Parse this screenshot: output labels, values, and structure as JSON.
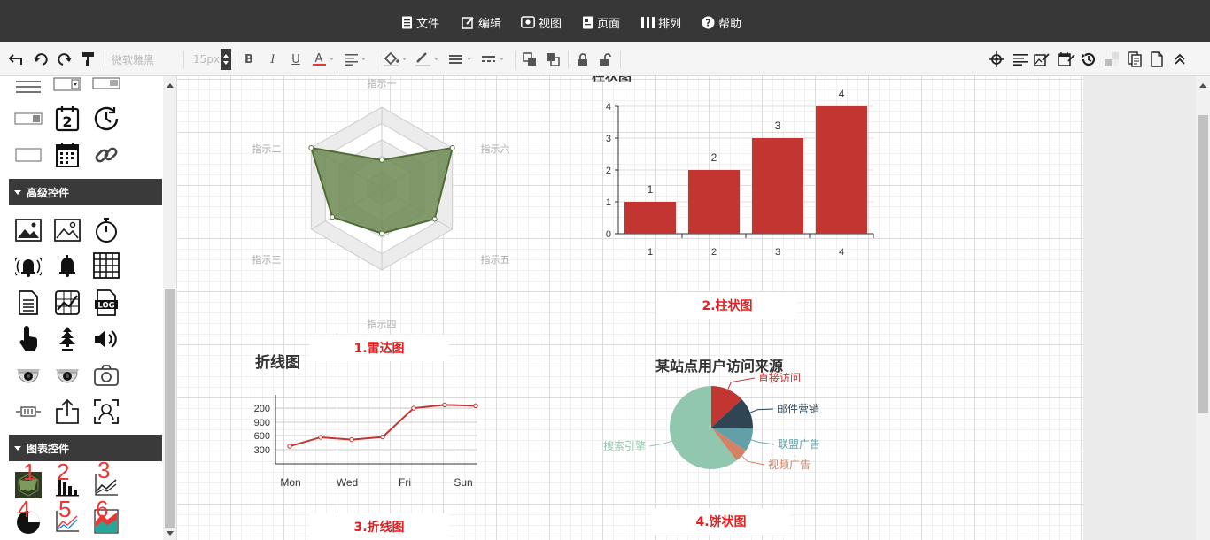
{
  "menu": {
    "items": [
      {
        "label": "文件",
        "icon": "file-icon"
      },
      {
        "label": "编辑",
        "icon": "edit-icon"
      },
      {
        "label": "视图",
        "icon": "eye-icon"
      },
      {
        "label": "页面",
        "icon": "page-icon"
      },
      {
        "label": "排列",
        "icon": "arrange-icon"
      },
      {
        "label": "帮助",
        "icon": "help-icon"
      }
    ]
  },
  "toolbar": {
    "font_family": "微软雅黑",
    "font_size": "15px",
    "left_tools": [
      "undo-back-icon",
      "undo-icon",
      "redo-icon",
      "format-painter-icon",
      "bold-icon",
      "italic-icon",
      "underline-icon",
      "font-color-icon",
      "align-icon",
      "fill-color-icon",
      "line-color-icon",
      "line-width-icon",
      "line-style-icon",
      "bring-front-icon",
      "send-back-icon",
      "lock-icon",
      "unlock-icon"
    ],
    "right_tools": [
      "crosshair-icon",
      "text-align-icon",
      "image-edit-icon",
      "calendar-edit-icon",
      "history-icon",
      "checker-icon",
      "copy-page-icon",
      "page-icon",
      "collapse-icon"
    ]
  },
  "sidebar": {
    "sections": [
      {
        "title": "高级控件"
      },
      {
        "title": "图表控件"
      }
    ],
    "basic_icons": [
      "list-lines-icon",
      "dropdown-icon",
      "dropdown-small-icon",
      "select-box-icon",
      "date-icon",
      "clock-icon",
      "textbox-icon",
      "calendar-icon",
      "link-icon"
    ],
    "advanced_icons": [
      "image-icon",
      "image-frame-icon",
      "stopwatch-icon",
      "alarm-icon",
      "bell-icon",
      "grid-table-icon",
      "document-icon",
      "trend-chart-icon",
      "log-file-icon",
      "touch-icon",
      "tree-icon",
      "speaker-icon",
      "camera-dome-icon",
      "camera-dome-2-icon",
      "camera-icon",
      "variable-icon",
      "share-icon",
      "face-scan-icon"
    ],
    "chart_icons": [
      "radar-chart-icon",
      "bar-chart-icon",
      "line-chart-icon",
      "pie-chart-icon",
      "multi-line-icon",
      "area-chart-icon"
    ],
    "chart_icon_numbers": [
      "1",
      "2",
      "3",
      "4",
      "5",
      "6"
    ]
  },
  "charts": {
    "radar": {
      "caption": "1.雷达图",
      "indicators": [
        "指示一",
        "指示二",
        "指示三",
        "指示四",
        "指示五",
        "指示六"
      ],
      "values": [
        0.35,
        1.0,
        0.7,
        0.55,
        0.75,
        1.0
      ],
      "color": "#6d8a52"
    },
    "bar": {
      "caption": "2.柱状图",
      "title": "柱状图",
      "categories": [
        "1",
        "2",
        "3",
        "4"
      ],
      "values": [
        1,
        2,
        3,
        4
      ],
      "yticks": [
        "0",
        "1",
        "2",
        "3",
        "4"
      ],
      "color": "#c23531"
    },
    "line": {
      "caption": "3.折线图",
      "title": "折线图",
      "xlabels": [
        "Mon",
        "Wed",
        "Fri",
        "Sun"
      ],
      "yticks": [
        "200",
        "900",
        "600",
        "300"
      ],
      "values": [
        820,
        930,
        901,
        934,
        1290,
        1330,
        1320
      ],
      "color": "#c23531"
    },
    "pie": {
      "caption": "4.饼状图",
      "title": "某站点用户访问来源",
      "slices": [
        {
          "name": "直接访问",
          "value": 335,
          "color": "#c23531"
        },
        {
          "name": "邮件营销",
          "value": 310,
          "color": "#2f4554"
        },
        {
          "name": "联盟广告",
          "value": 234,
          "color": "#61a0a8"
        },
        {
          "name": "视频广告",
          "value": 135,
          "color": "#d48265"
        },
        {
          "name": "搜索引擎",
          "value": 1548,
          "color": "#91c7ae"
        }
      ]
    }
  },
  "colors": {
    "menubar": "#373737",
    "accent_red": "#e53935",
    "caption_red": "#e02020"
  }
}
